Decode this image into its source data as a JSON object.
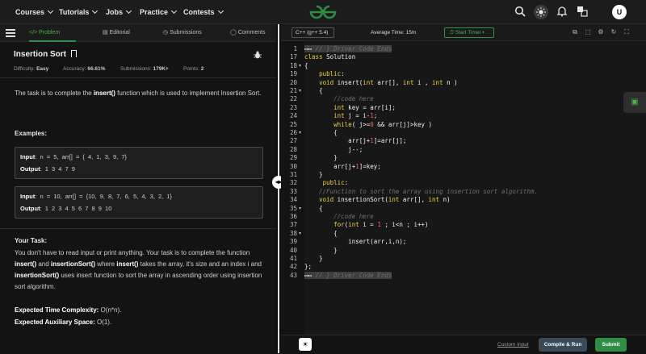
{
  "nav": {
    "items": [
      "Courses",
      "Tutorials",
      "Jobs",
      "Practice",
      "Contests"
    ],
    "logo": "GfG",
    "avatar_letter": "U"
  },
  "tabs": [
    "Problem",
    "Editorial",
    "Submissions",
    "Comments"
  ],
  "problem": {
    "title": "Insertion Sort",
    "difficulty_label": "Difficulty:",
    "difficulty": "Easy",
    "accuracy_label": "Accuracy:",
    "accuracy": "66.61%",
    "submissions_label": "Submissions:",
    "submissions": "179K+",
    "points_label": "Points:",
    "points": "2",
    "intro_1": "The task is to complete the ",
    "intro_fn": "insert()",
    "intro_2": " function which is used to implement Insertion Sort.",
    "examples_heading": "Examples:",
    "example1_input_label": "Input",
    "example1_input": ": n = 5, arr[] = { 4, 1, 3, 9, 7}",
    "example1_output_label": "Output",
    "example1_output": ": 1 3 4 7 9",
    "example2_input_label": "Input",
    "example2_input": ": n = 10, arr[] = {10, 9, 8, 7, 6, 5, 4, 3, 2, 1}",
    "example2_output_label": "Output",
    "example2_output": ": 1 2 3 4 5 6 7 8 9 10",
    "task_heading": "Your Task:",
    "task_1": "You don't have to read input or print anything. Your task is to complete the function ",
    "task_fn1": "insert()",
    "task_2": " and ",
    "task_fn2": "insertionSort()",
    "task_3": " where ",
    "task_fn3": "insert()",
    "task_4": " takes the array, it's size and an index i and ",
    "task_fn4": "insertionSort()",
    "task_5": " uses insert function to sort the array in ascending order using insertion sort algorithm.",
    "time_label": "Expected Time Complexity:",
    "time_value": " O(n*n).",
    "space_label": "Expected Auxiliary Space:",
    "space_value": " O(1)."
  },
  "editor": {
    "language": "C++ (g++ 5.4)",
    "average_time": "Average Time: 15m",
    "timer_label": "Start Timer",
    "line_numbers": [
      "1",
      "17",
      "18",
      "19",
      "20",
      "21",
      "22",
      "23",
      "24",
      "25",
      "26",
      "27",
      "28",
      "29",
      "30",
      "31",
      "32",
      "33",
      "34",
      "35",
      "36",
      "37",
      "38",
      "39",
      "40",
      "41",
      "42",
      "43"
    ],
    "code_lines": [
      "// } Driver Code Ends",
      "class Solution",
      "{",
      "    public:",
      "    void insert(int arr[], int i , int n )",
      "    {",
      "        //code here",
      "        int key = arr[i];",
      "        int j = i-1;",
      "        while( j>=0 && arr[j]>key )",
      "        {",
      "            arr[j+1]=arr[j];",
      "            j--;",
      "        }",
      "        arr[j+1]=key;",
      "    }",
      "     public:",
      "    //Function to sort the array using insertion sort algorithm.",
      "    void insertionSort(int arr[], int n)",
      "    {",
      "        //code here",
      "        for(int i = 1 ; i<n ; i++)",
      "        {",
      "            insert(arr,i,n);",
      "        }",
      "    }",
      "};",
      "// } Driver Code Ends"
    ]
  },
  "bottom": {
    "custom_input": "Custom Input",
    "compile_run": "Compile & Run",
    "submit": "Submit"
  }
}
